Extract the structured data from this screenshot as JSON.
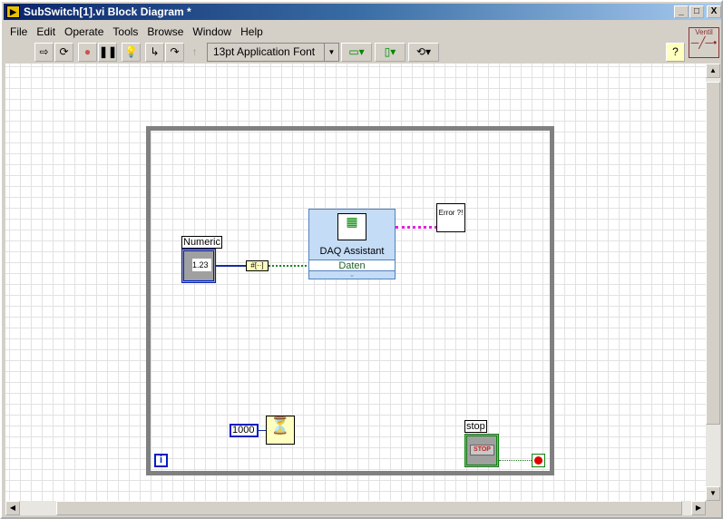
{
  "window": {
    "title": "SubSwitch[1].vi Block Diagram *",
    "minimize": "_",
    "maximize": "□",
    "close": "X"
  },
  "menu": [
    "File",
    "Edit",
    "Operate",
    "Tools",
    "Browse",
    "Window",
    "Help"
  ],
  "toolbar": {
    "font": "13pt Application Font",
    "help": "?"
  },
  "connector_pane": {
    "label": "Ventil"
  },
  "diagram": {
    "numeric_label": "Numeric",
    "numeric_value": "1.23",
    "daq_title": "DAQ Assistant",
    "daq_terminal": "Daten",
    "error_label": "Error ?!",
    "wait_constant": "1000",
    "stop_label": "stop",
    "stop_button": "STOP",
    "iteration": "i"
  }
}
